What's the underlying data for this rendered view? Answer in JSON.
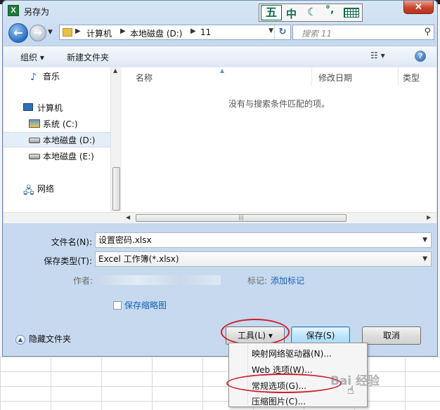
{
  "title": "另存为",
  "ime": {
    "logo": "五",
    "mode": "中",
    "moon": "☾",
    "punct": "°,"
  },
  "address": {
    "crumbs": [
      "计算机",
      "本地磁盘 (D:)",
      "11"
    ],
    "search_placeholder": "搜索 11"
  },
  "toolbar": {
    "organize": "组织 ▾",
    "new_folder": "新建文件夹",
    "view": "☷ ▾",
    "help": "?"
  },
  "nav": {
    "music": "音乐",
    "computer": "计算机",
    "system_c": "系统 (C:)",
    "local_d": "本地磁盘 (D:)",
    "local_e": "本地磁盘 (E:)",
    "network": "网络"
  },
  "columns": {
    "name": "名称",
    "modified": "修改日期",
    "type": "类型"
  },
  "empty_message": "没有与搜索条件匹配的项。",
  "form": {
    "filename_label": "文件名(N):",
    "filename_value": "设置密码.xlsx",
    "filetype_label": "保存类型(T):",
    "filetype_value": "Excel 工作簿(*.xlsx)",
    "author_label": "作者:",
    "tags_label": "标记:",
    "tags_link": "添加标记",
    "thumbnail_label": "保存缩略图"
  },
  "footer": {
    "hide_folders": "隐藏文件夹",
    "tools": "工具(L)",
    "save": "保存(S)",
    "cancel": "取消"
  },
  "tools_menu": [
    "映射网络驱动器(N)...",
    "Web 选项(W)...",
    "常规选项(G)...",
    "压缩图片(C)..."
  ],
  "watermark": "Bai 经验"
}
